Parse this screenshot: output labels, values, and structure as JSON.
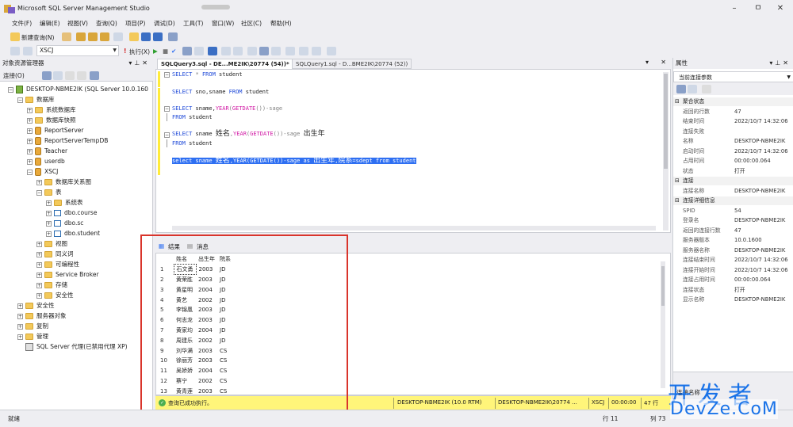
{
  "window": {
    "title": "Microsoft SQL Server Management Studio",
    "controls": {
      "minimize": "–",
      "restore": "ㅁ",
      "close": "✕"
    }
  },
  "menu": [
    "文件(F)",
    "编辑(E)",
    "视图(V)",
    "查询(Q)",
    "项目(P)",
    "调试(D)",
    "工具(T)",
    "窗口(W)",
    "社区(C)",
    "帮助(H)"
  ],
  "toolbar": {
    "new_query": "新建查询(N)",
    "database": "XSCJ",
    "execute": "执行(X)"
  },
  "object_explorer": {
    "title": "对象资源管理器",
    "connect": "连接(O)",
    "tree": [
      {
        "label": "DESKTOP-NBME2IK (SQL Server 10.0.160",
        "level": 0,
        "icon": "server-icon",
        "expanded": "−"
      },
      {
        "label": "数据库",
        "level": 1,
        "icon": "folder-icon",
        "expanded": "−"
      },
      {
        "label": "系统数据库",
        "level": 2,
        "icon": "folder-icon",
        "expanded": "+"
      },
      {
        "label": "数据库快照",
        "level": 2,
        "icon": "folder-icon",
        "expanded": "+"
      },
      {
        "label": "ReportServer",
        "level": 2,
        "icon": "database-icon",
        "expanded": "+"
      },
      {
        "label": "ReportServerTempDB",
        "level": 2,
        "icon": "database-icon",
        "expanded": "+"
      },
      {
        "label": "Teacher",
        "level": 2,
        "icon": "database-icon",
        "expanded": "+"
      },
      {
        "label": "userdb",
        "level": 2,
        "icon": "database-icon",
        "expanded": "+"
      },
      {
        "label": "XSCJ",
        "level": 2,
        "icon": "database-icon",
        "expanded": "−"
      },
      {
        "label": "数据库关系图",
        "level": 3,
        "icon": "folder-icon",
        "expanded": "+"
      },
      {
        "label": "表",
        "level": 3,
        "icon": "folder-icon",
        "expanded": "−"
      },
      {
        "label": "系统表",
        "level": 4,
        "icon": "folder-icon",
        "expanded": "+"
      },
      {
        "label": "dbo.course",
        "level": 4,
        "icon": "table-icon",
        "expanded": "+"
      },
      {
        "label": "dbo.sc",
        "level": 4,
        "icon": "table-icon",
        "expanded": "+"
      },
      {
        "label": "dbo.student",
        "level": 4,
        "icon": "table-icon",
        "expanded": "+"
      },
      {
        "label": "视图",
        "level": 3,
        "icon": "folder-icon",
        "expanded": "+"
      },
      {
        "label": "同义词",
        "level": 3,
        "icon": "folder-icon",
        "expanded": "+"
      },
      {
        "label": "可编程性",
        "level": 3,
        "icon": "folder-icon",
        "expanded": "+"
      },
      {
        "label": "Service Broker",
        "level": 3,
        "icon": "folder-icon",
        "expanded": "+"
      },
      {
        "label": "存储",
        "level": 3,
        "icon": "folder-icon",
        "expanded": "+"
      },
      {
        "label": "安全性",
        "level": 3,
        "icon": "folder-icon",
        "expanded": "+"
      },
      {
        "label": "安全性",
        "level": 1,
        "icon": "folder-icon",
        "expanded": "+"
      },
      {
        "label": "服务器对象",
        "level": 1,
        "icon": "folder-icon",
        "expanded": "+"
      },
      {
        "label": "复制",
        "level": 1,
        "icon": "folder-icon",
        "expanded": "+"
      },
      {
        "label": "管理",
        "level": 1,
        "icon": "folder-icon",
        "expanded": "+"
      },
      {
        "label": "SQL Server 代理(已禁用代理 XP)",
        "level": 1,
        "icon": "agent-icon",
        "expanded": ""
      }
    ]
  },
  "editor": {
    "tabs": [
      {
        "label": "SQLQuery3.sql - DE...ME2IK\\20774 (54))*",
        "active": true
      },
      {
        "label": "SQLQuery1.sql - D...BME2IK\\20774 (52))",
        "active": false
      }
    ],
    "lines": {
      "l1": [
        "SELECT",
        " * ",
        "FROM",
        " student"
      ],
      "l2": [
        "SELECT",
        " sno,sname ",
        "FROM",
        " student"
      ],
      "l3": [
        "SELECT",
        " sname,",
        "YEAR",
        "(",
        "GETDATE",
        "())-sage"
      ],
      "l4": [
        "FROM",
        " student"
      ],
      "l5": [
        "SELECT",
        " sname ",
        "姓名",
        ",",
        "YEAR",
        "(",
        "GETDATE",
        "())-sage ",
        "出生年"
      ],
      "l6": [
        "FROM",
        " student"
      ],
      "l7": [
        "select sname ",
        "姓名",
        ",YEAR(GETDATE())-sage as ",
        "出生年",
        ",",
        "院系",
        "=sdept from student"
      ]
    }
  },
  "results": {
    "tab_results": "结果",
    "tab_messages": "消息",
    "columns": [
      "姓名",
      "出生年",
      "院系"
    ],
    "rows": [
      [
        "1",
        "石文勇",
        "2003",
        "JD"
      ],
      [
        "2",
        "黄荣胜",
        "2003",
        "JD"
      ],
      [
        "3",
        "黄星明",
        "2004",
        "JD"
      ],
      [
        "4",
        "黄艺",
        "2002",
        "JD"
      ],
      [
        "5",
        "李锦凰",
        "2003",
        "JD"
      ],
      [
        "6",
        "何志龙",
        "2003",
        "JD"
      ],
      [
        "7",
        "黄家均",
        "2004",
        "JD"
      ],
      [
        "8",
        "周建乐",
        "2002",
        "JD"
      ],
      [
        "9",
        "刘华满",
        "2003",
        "CS"
      ],
      [
        "10",
        "徐丽芳",
        "2003",
        "CS"
      ],
      [
        "11",
        "吴娇娇",
        "2004",
        "CS"
      ],
      [
        "12",
        "蔡宁",
        "2002",
        "CS"
      ],
      [
        "13",
        "黄青莲",
        "2003",
        "CS"
      ],
      [
        "14",
        "覃诗怡",
        "2003",
        "CS"
      ]
    ]
  },
  "query_status": {
    "message": "查询已成功执行。",
    "server": "DESKTOP-NBME2IK (10.0 RTM)",
    "user": "DESKTOP-NBME2IK\\20774 ...",
    "database": "XSCJ",
    "elapsed": "00:00:00",
    "rows": "47 行"
  },
  "properties": {
    "title": "属性",
    "selector": "当前连接参数",
    "items": [
      {
        "kind": "cat",
        "label": "聚合状态",
        "exp": "⊟"
      },
      {
        "kind": "row",
        "k": "返回的行数",
        "v": "47"
      },
      {
        "kind": "row",
        "k": "结束时间",
        "v": "2022/10/7 14:32:06"
      },
      {
        "kind": "row",
        "k": "连接失败",
        "v": ""
      },
      {
        "kind": "row",
        "k": "名称",
        "v": "DESKTOP-NBME2IK"
      },
      {
        "kind": "row",
        "k": "启动时间",
        "v": "2022/10/7 14:32:06"
      },
      {
        "kind": "row",
        "k": "占用时间",
        "v": "00:00:00.064"
      },
      {
        "kind": "row",
        "k": "状态",
        "v": "打开"
      },
      {
        "kind": "cat",
        "label": "连接",
        "exp": "⊟"
      },
      {
        "kind": "row",
        "k": "连接名称",
        "v": "DESKTOP-NBME2IK"
      },
      {
        "kind": "cat",
        "label": "连接详细信息",
        "exp": "⊟"
      },
      {
        "kind": "row",
        "k": "SPID",
        "v": "54"
      },
      {
        "kind": "row",
        "k": "登录名",
        "v": "DESKTOP-NBME2IK"
      },
      {
        "kind": "row",
        "k": "返回的连接行数",
        "v": "47"
      },
      {
        "kind": "row",
        "k": "服务器版本",
        "v": "10.0.1600"
      },
      {
        "kind": "row",
        "k": "服务器名称",
        "v": "DESKTOP-NBME2IK"
      },
      {
        "kind": "row",
        "k": "连接结束时间",
        "v": "2022/10/7 14:32:06"
      },
      {
        "kind": "row",
        "k": "连接开始时间",
        "v": "2022/10/7 14:32:06"
      },
      {
        "kind": "row",
        "k": "连接占用时间",
        "v": "00:00:00.064"
      },
      {
        "kind": "row",
        "k": "连接状态",
        "v": "打开"
      },
      {
        "kind": "row",
        "k": "显示名称",
        "v": "DESKTOP-NBME2IK"
      }
    ],
    "description": "连接名称"
  },
  "statusbar": {
    "ready": "就绪",
    "row": "行 11",
    "col": "列 73"
  },
  "watermark": {
    "top": "开发者",
    "bottom": "DevZe.CoM"
  },
  "colors": {
    "keyword": "#1f4ad8",
    "function": "#d11aa5",
    "selection": "#2e6ff2",
    "status_yellow": "#fff57a",
    "highlight_red": "#d9342b",
    "watermark_blue": "#1a73e8"
  }
}
